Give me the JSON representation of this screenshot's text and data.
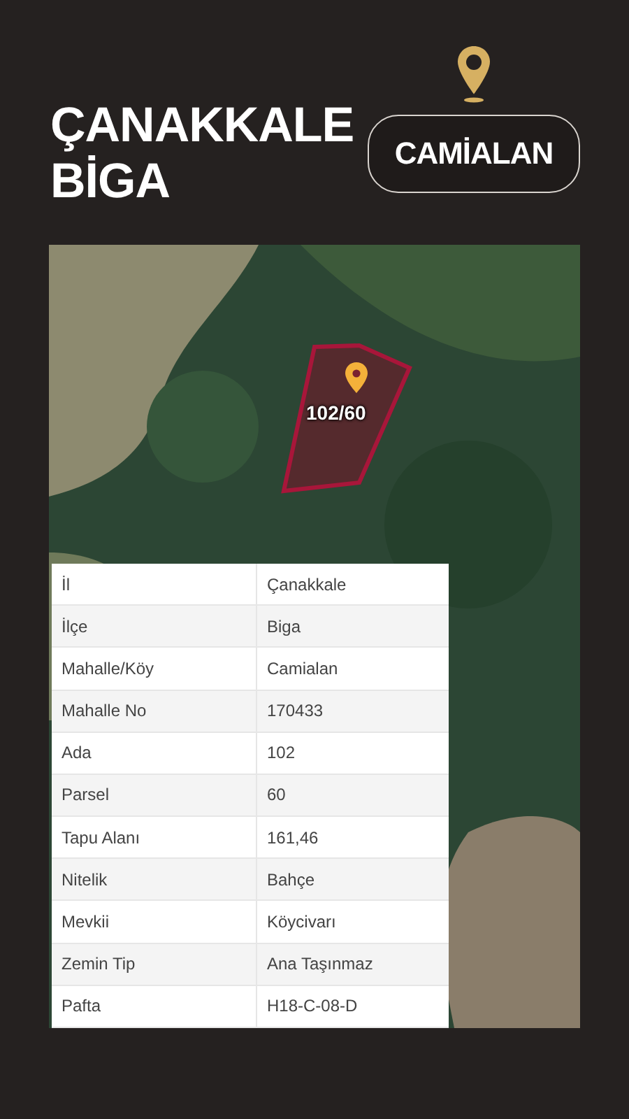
{
  "header": {
    "title_lines": [
      "ÇANAKKALE",
      "BİGA"
    ],
    "location_button": "CAMİALAN"
  },
  "map": {
    "parcel_label": "102/60"
  },
  "table": {
    "rows": [
      {
        "label": "İl",
        "value": "Çanakkale"
      },
      {
        "label": "İlçe",
        "value": "Biga"
      },
      {
        "label": "Mahalle/Köy",
        "value": "Camialan"
      },
      {
        "label": "Mahalle No",
        "value": "170433"
      },
      {
        "label": "Ada",
        "value": "102"
      },
      {
        "label": "Parsel",
        "value": "60"
      },
      {
        "label": "Tapu Alanı",
        "value": "161,46"
      },
      {
        "label": "Nitelik",
        "value": "Bahçe"
      },
      {
        "label": "Mevkii",
        "value": "Köycivarı"
      },
      {
        "label": "Zemin Tip",
        "value": "Ana Taşınmaz"
      },
      {
        "label": "Pafta",
        "value": "H18-C-08-D"
      }
    ]
  }
}
